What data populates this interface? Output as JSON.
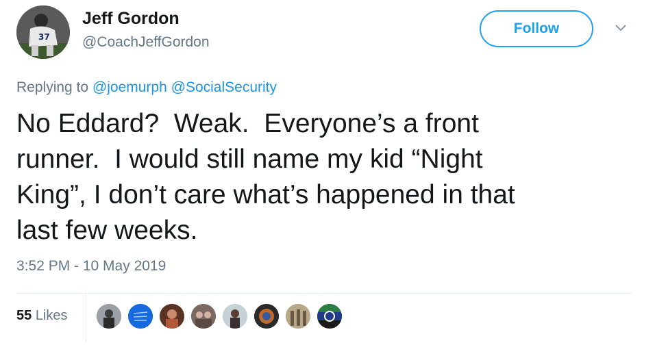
{
  "author": {
    "name": "Jeff Gordon",
    "handle": "@CoachJeffGordon",
    "avatar_icon": "football-player-avatar"
  },
  "actions": {
    "follow_label": "Follow",
    "menu_icon": "chevron-down-icon"
  },
  "reply": {
    "prefix": "Replying to",
    "mentions": [
      "@joemurph",
      "@SocialSecurity"
    ]
  },
  "tweet": {
    "lines": [
      "No Eddard?  Weak.  Everyone’s a front",
      "runner.  I would still name my kid “Night",
      "King”, I don’t care what’s happened in that",
      "last few weeks."
    ],
    "timestamp": "3:52 PM - 10 May 2019"
  },
  "stats": {
    "likes_count": "55",
    "likes_label": "Likes"
  },
  "liker_avatars": [
    {
      "name": "liker-avatar-1",
      "color": "#8a8a8a"
    },
    {
      "name": "liker-avatar-2",
      "color": "#1a73e8"
    },
    {
      "name": "liker-avatar-3",
      "color": "#7a4a3a"
    },
    {
      "name": "liker-avatar-4",
      "color": "#9a7a6a"
    },
    {
      "name": "liker-avatar-5",
      "color": "#b5c4cc"
    },
    {
      "name": "liker-avatar-6",
      "color": "#3a3a3a"
    },
    {
      "name": "liker-avatar-7",
      "color": "#a89878"
    },
    {
      "name": "liker-avatar-8",
      "color": "#2d6a3e"
    }
  ],
  "colors": {
    "accent": "#1da1f2",
    "mention": "#1b95e0",
    "muted": "#657786",
    "text": "#14171a"
  }
}
